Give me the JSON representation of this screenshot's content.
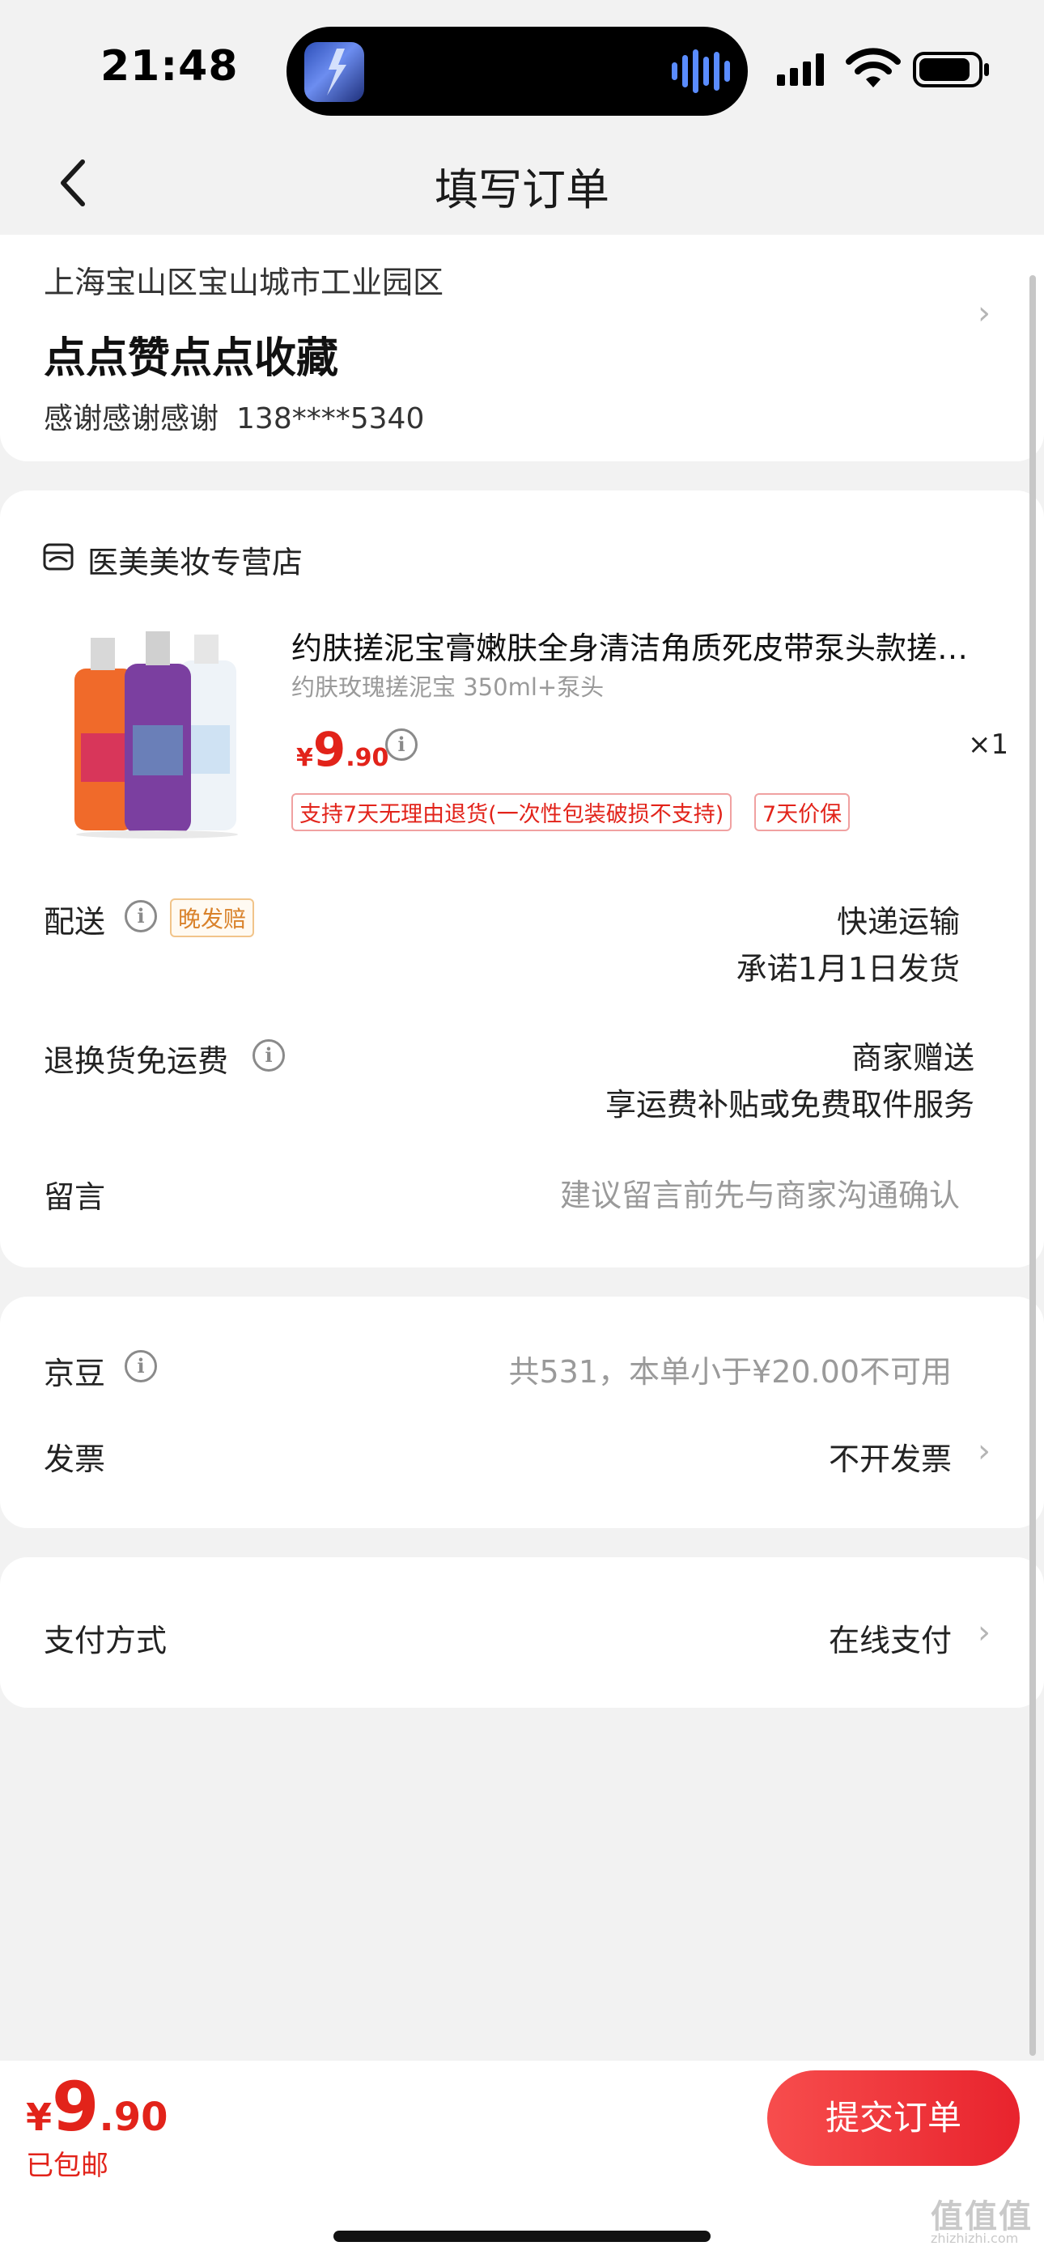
{
  "status_bar": {
    "time": "21:48"
  },
  "nav": {
    "title": "填写订单"
  },
  "address": {
    "line": "上海宝山区宝山城市工业园区",
    "name": "点点赞点点收藏",
    "contact_name": "感谢感谢感谢",
    "phone": "138****5340"
  },
  "store": {
    "name": "医美美妆专营店",
    "product": {
      "title": "约肤搓泥宝膏嫩肤全身清洁角质死皮带泵头款搓…",
      "spec": "约肤玫瑰搓泥宝 350ml+泵头",
      "price_currency": "¥",
      "price_int": "9",
      "price_dec": ".90",
      "quantity": "×1",
      "tags": [
        "支持7天无理由退货(一次性包装破损不支持)",
        "7天价保"
      ]
    },
    "delivery": {
      "label": "配送",
      "badge": "晚发赔",
      "method": "快递运输",
      "promise": "承诺1月1日发货"
    },
    "return_shipping": {
      "label": "退换货免运费",
      "value": "商家赠送",
      "sub": "享运费补贴或免费取件服务"
    },
    "message": {
      "label": "留言",
      "placeholder": "建议留言前先与商家沟通确认"
    }
  },
  "benefits": {
    "jingdou": {
      "label": "京豆",
      "value": "共531，本单小于¥20.00不可用"
    },
    "invoice": {
      "label": "发票",
      "value": "不开发票"
    }
  },
  "payment": {
    "label": "支付方式",
    "value": "在线支付"
  },
  "bottom": {
    "currency": "¥",
    "total_int": "9",
    "total_dec": ".90",
    "shipping_note": "已包邮",
    "submit_label": "提交订单"
  },
  "watermark": {
    "text": "值值值",
    "sub": "zhizhizhi.com"
  }
}
